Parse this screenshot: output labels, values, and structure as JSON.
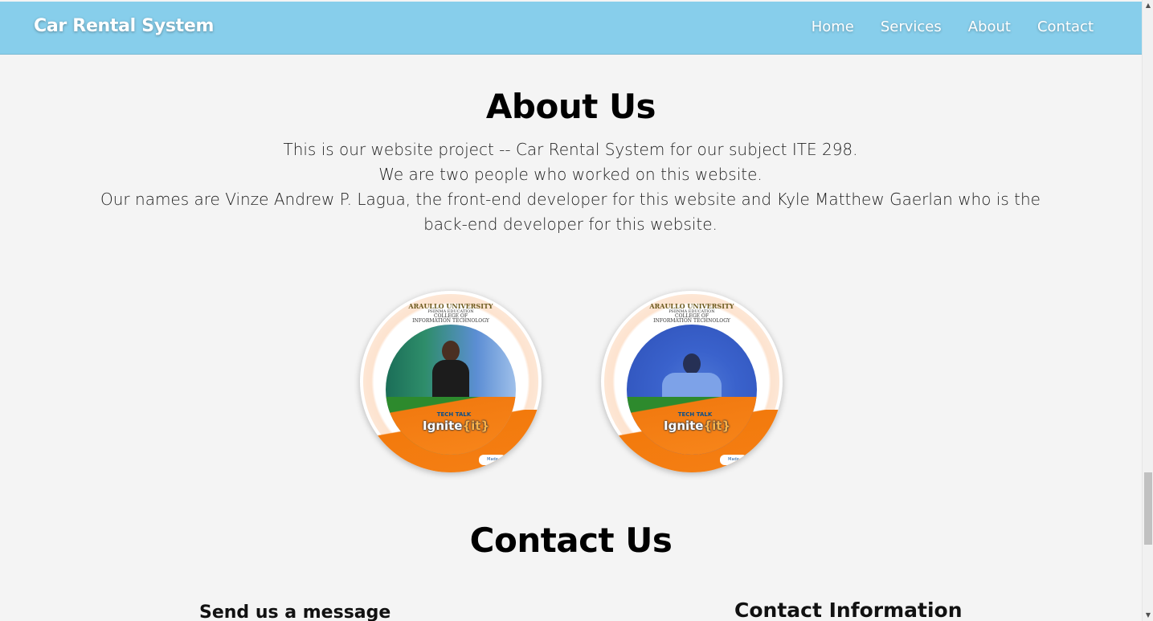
{
  "navbar": {
    "brand": "Car Rental System",
    "links": [
      "Home",
      "Services",
      "About",
      "Contact"
    ]
  },
  "about": {
    "title": "About Us",
    "lines": [
      "This is our website project -- Car Rental System for our subject ITE 298.",
      "We are two people who worked on this website.",
      "Our names are Vinze Andrew P. Lagua, the front-end developer for this website and Kyle Matthew Gaerlan who is the back-end developer for this website."
    ]
  },
  "team_photos": [
    {
      "frame_university": "ARAULLO UNIVERSITY",
      "frame_sub1": "PHINMA EDUCATION",
      "frame_sub2": "COLLEGE OF",
      "frame_sub3": "INFORMATION TECHNOLOGY",
      "badge_small": "TECH TALK",
      "badge_big": "Ignite",
      "badge_brace": "{it}",
      "tag": "Made"
    },
    {
      "frame_university": "ARAULLO UNIVERSITY",
      "frame_sub1": "PHINMA EDUCATION",
      "frame_sub2": "COLLEGE OF",
      "frame_sub3": "INFORMATION TECHNOLOGY",
      "badge_small": "TECH TALK",
      "badge_big": "Ignite",
      "badge_brace": "{it}",
      "tag": "Made"
    }
  ],
  "contact": {
    "title": "Contact Us",
    "send_heading": "Send us a message",
    "info_heading": "Contact Information"
  },
  "colors": {
    "navbar_bg": "#87ceeb",
    "page_bg": "#f4f4f4"
  }
}
